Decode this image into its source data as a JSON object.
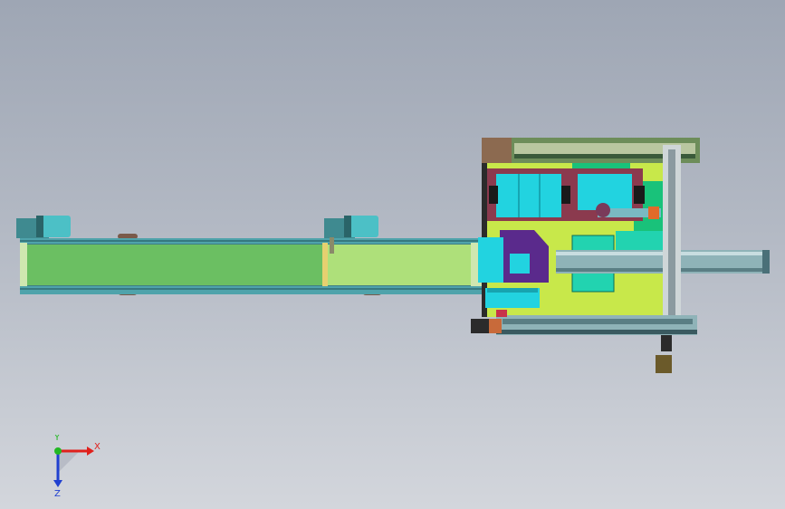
{
  "viewport": {
    "background_top": "#9ea6b4",
    "background_bottom": "#d3d6dc"
  },
  "model": {
    "components": [
      "conveyor-belt",
      "drive-motor-left",
      "drive-motor-middle",
      "work-station-base",
      "gantry-rail",
      "cylinder-module-left",
      "cylinder-module-right",
      "control-box",
      "purple-bracket",
      "linear-guide-right"
    ],
    "colors": {
      "conveyor_belt": "#6bbf62",
      "conveyor_belt_light": "#aee07a",
      "frame_teal": "#2d8c92",
      "cyan_parts": "#22d3e0",
      "base_plate": "#c8e84a",
      "brown_plate": "#8c6a50",
      "purple_bracket": "#5a2a8c",
      "green_panel": "#19c27a",
      "rail_gray": "#8fb3b8"
    }
  },
  "triad": {
    "x_label": "X",
    "y_label": "Y",
    "z_label": "Z",
    "x_color": "#e0201c",
    "z_color": "#2040d0",
    "y_color": "#22b822"
  }
}
